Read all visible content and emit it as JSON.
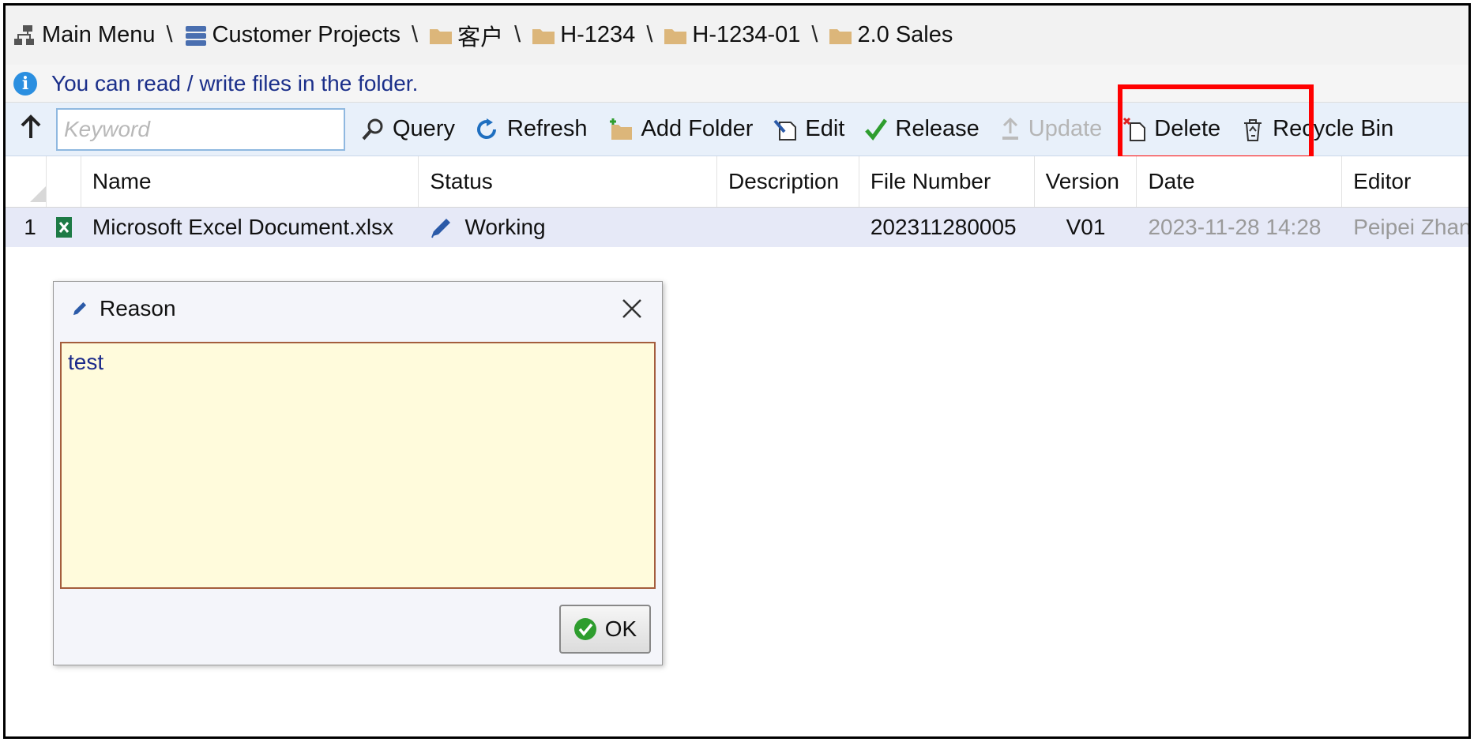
{
  "breadcrumb": {
    "items": [
      "Main Menu",
      "Customer Projects",
      "客户",
      "H-1234",
      "H-1234-01",
      "2.0 Sales"
    ],
    "separator": "\\"
  },
  "info": {
    "message": "You can read / write files in the folder."
  },
  "toolbar": {
    "keyword_placeholder": "Keyword",
    "query": "Query",
    "refresh": "Refresh",
    "add_folder": "Add Folder",
    "edit": "Edit",
    "release": "Release",
    "update": "Update",
    "delete": "Delete",
    "recycle_bin": "Recycle Bin"
  },
  "grid": {
    "columns": [
      "Name",
      "Status",
      "Description",
      "File Number",
      "Version",
      "Date",
      "Editor"
    ],
    "rows": [
      {
        "index": "1",
        "name": "Microsoft Excel Document.xlsx",
        "status": "Working",
        "description": "",
        "file_number": "202311280005",
        "version": "V01",
        "date": "2023-11-28 14:28",
        "editor": "Peipei Zhan"
      }
    ]
  },
  "dialog": {
    "title": "Reason",
    "reason_value": "test",
    "ok_label": "OK"
  },
  "colors": {
    "accent": "#2b8fe0",
    "highlight": "#ff0000",
    "row_selected": "#e6e9f7",
    "reason_bg": "#fffbdc"
  }
}
